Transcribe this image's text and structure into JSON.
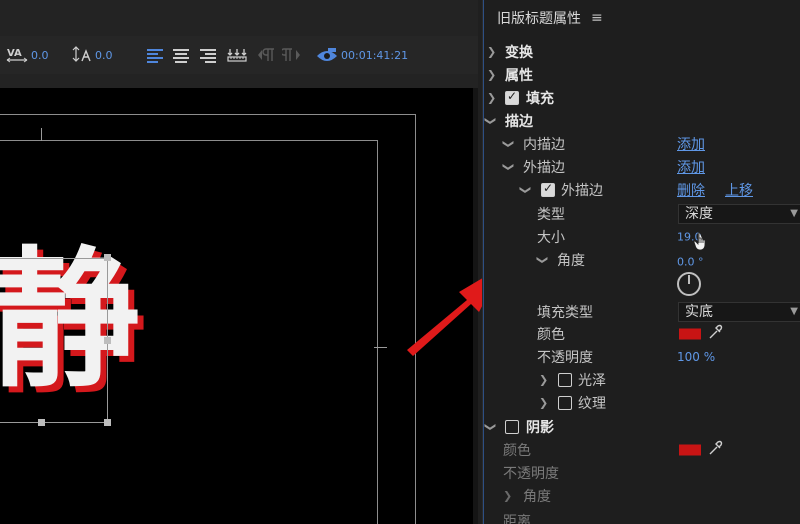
{
  "toolbar": {
    "kerning_value": "0.0",
    "tracking_value": "0.0",
    "timecode": "00:01:41:21"
  },
  "canvas": {
    "glyph": "静"
  },
  "panel": {
    "title": "旧版标题属性",
    "menu_icon": "≡",
    "transform": "变换",
    "properties": "属性",
    "fill": "填充",
    "stroke": "描边",
    "inner_stroke": "内描边",
    "inner_stroke_add": "添加",
    "outer_stroke": "外描边",
    "outer_stroke_add": "添加",
    "outer_stroke_item": "外描边",
    "delete": "删除",
    "move_up": "上移",
    "type_label": "类型",
    "type_value": "深度",
    "size_label": "大小",
    "size_value": "19.0",
    "angle_label": "角度",
    "angle_value": "0.0 °",
    "fill_type_label": "填充类型",
    "fill_type_value": "实底",
    "color_label": "颜色",
    "stroke_color": "#c81414",
    "opacity_label": "不透明度",
    "opacity_value": "100 %",
    "sheen": "光泽",
    "texture": "纹理",
    "shadow": "阴影",
    "shadow_color_label": "颜色",
    "shadow_color": "#c81414",
    "shadow_opacity_label": "不透明度",
    "shadow_angle_label": "角度",
    "shadow_distance_label": "距离"
  }
}
